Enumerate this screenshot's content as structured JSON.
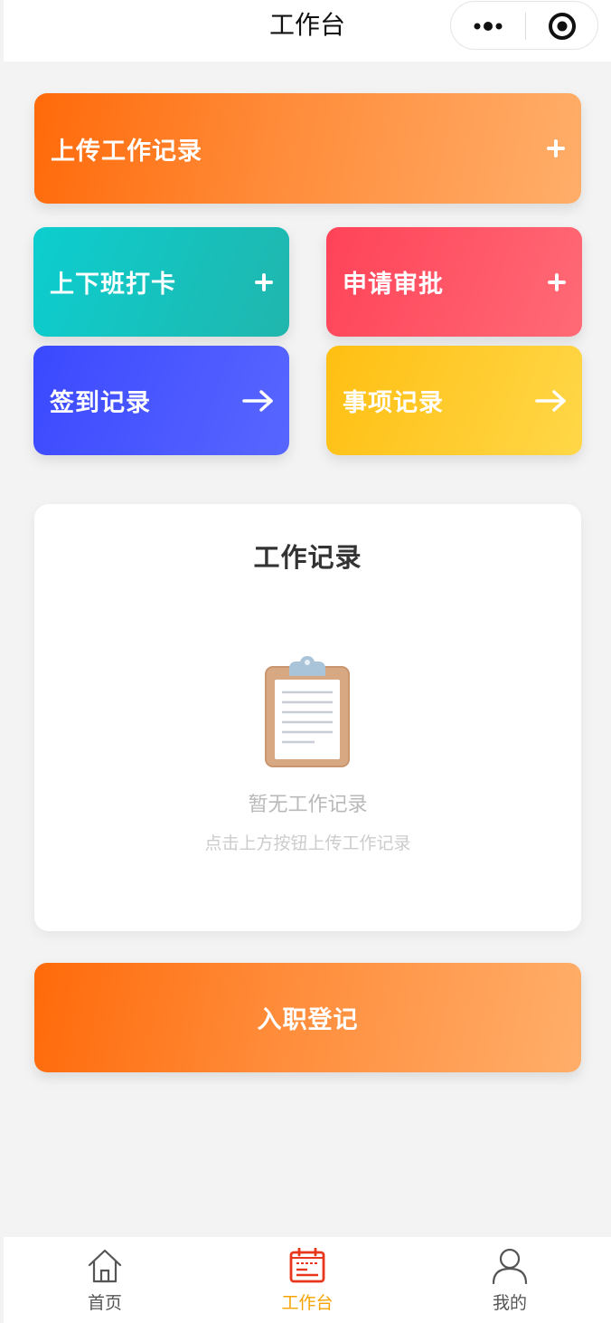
{
  "navbar": {
    "title": "工作台",
    "more_icon": "more-dots-icon",
    "close_icon": "capsule-close-icon"
  },
  "actions": {
    "upload": {
      "label": "上传工作记录",
      "icon": "plus-icon"
    },
    "clock": {
      "label": "上下班打卡",
      "icon": "plus-icon"
    },
    "approval": {
      "label": "申请审批",
      "icon": "plus-icon"
    },
    "checkin_records": {
      "label": "签到记录",
      "icon": "arrow-right-icon"
    },
    "matter_records": {
      "label": "事项记录",
      "icon": "arrow-right-icon"
    }
  },
  "work_records": {
    "title": "工作记录",
    "empty_icon": "clipboard-icon",
    "empty_title": "暂无工作记录",
    "empty_hint": "点击上方按钮上传工作记录"
  },
  "onboarding": {
    "label": "入职登记"
  },
  "tabbar": {
    "items": [
      {
        "label": "首页",
        "icon": "home-icon",
        "active": false
      },
      {
        "label": "工作台",
        "icon": "workbench-icon",
        "active": true
      },
      {
        "label": "我的",
        "icon": "user-icon",
        "active": false
      }
    ]
  },
  "colors": {
    "accent_orange": "#ff6a0a",
    "teal": "#0ccecf",
    "red": "#ff4358",
    "blue": "#3b49ff",
    "yellow": "#ffbf12",
    "active_tab": "#f5a300",
    "background": "#f3f3f3"
  }
}
